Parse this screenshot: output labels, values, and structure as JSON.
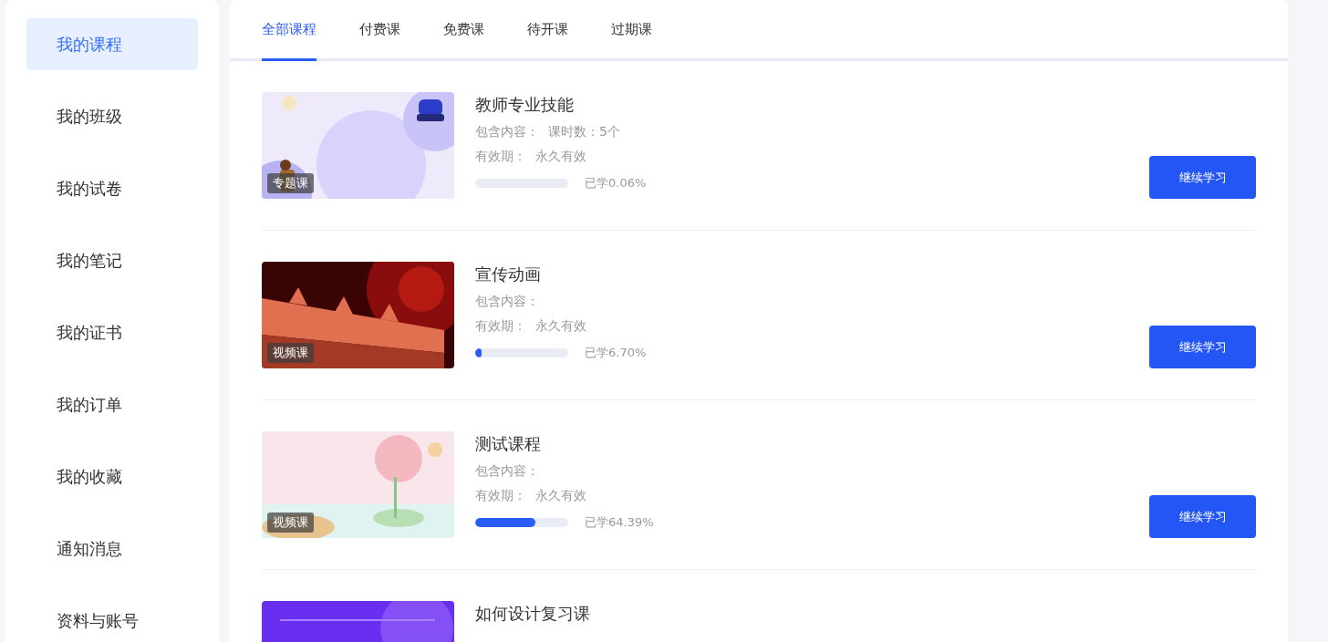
{
  "sidebar": {
    "items": [
      {
        "label": "我的课程",
        "selected": true
      },
      {
        "label": "我的班级",
        "selected": false
      },
      {
        "label": "我的试卷",
        "selected": false
      },
      {
        "label": "我的笔记",
        "selected": false
      },
      {
        "label": "我的证书",
        "selected": false
      },
      {
        "label": "我的订单",
        "selected": false
      },
      {
        "label": "我的收藏",
        "selected": false
      },
      {
        "label": "通知消息",
        "selected": false
      },
      {
        "label": "资料与账号",
        "selected": false
      }
    ]
  },
  "tabs": [
    {
      "label": "全部课程",
      "selected": true
    },
    {
      "label": "付费课",
      "selected": false
    },
    {
      "label": "免费课",
      "selected": false
    },
    {
      "label": "待开课",
      "selected": false
    },
    {
      "label": "过期课",
      "selected": false
    }
  ],
  "courses": [
    {
      "badge": "专题课",
      "title": "教师专业技能",
      "contents_label": "包含内容：",
      "contents": "课时数：5个",
      "validity_label": "有效期：",
      "validity": "永久有效",
      "level": 0.0006,
      "progress": "已学0.06%",
      "button": "继续学习"
    },
    {
      "badge": "视频课",
      "title": "宣传动画",
      "contents_label": "包含内容：",
      "validity_label": "有效期：",
      "validity": "永久有效",
      "level": 0.067,
      "progress": "已学6.70%",
      "button": "继续学习"
    },
    {
      "badge": "视频课",
      "title": "测试课程",
      "contents_label": "包含内容：",
      "validity_label": "有效期：",
      "validity": "永久有效",
      "level": 0.6439,
      "progress": "已学64.39%",
      "button": "继续学习"
    },
    {
      "title": "如何设计复习课"
    }
  ]
}
